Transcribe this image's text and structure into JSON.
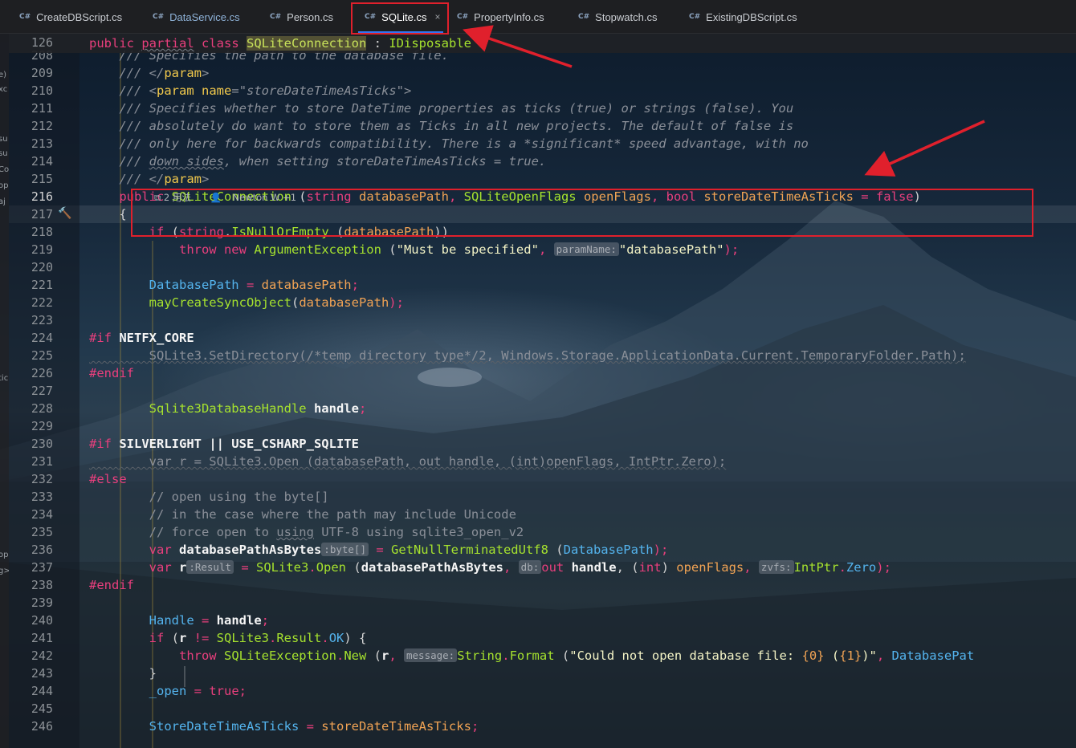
{
  "tabs": [
    {
      "label": "CreateDBScript.cs",
      "badge": "C#",
      "active": false
    },
    {
      "label": "DataService.cs",
      "badge": "C#",
      "active": false
    },
    {
      "label": "Person.cs",
      "badge": "C#",
      "active": false
    },
    {
      "label": "SQLite.cs",
      "badge": "C#",
      "active": true
    },
    {
      "label": "PropertyInfo.cs",
      "badge": "C#",
      "active": false
    },
    {
      "label": "Stopwatch.cs",
      "badge": "C#",
      "active": false
    },
    {
      "label": "ExistingDBScript.cs",
      "badge": "C#",
      "active": false
    }
  ],
  "tab_close_glyph": "×",
  "left_panel_fragments": [
    "e)",
    "xc",
    "su",
    "su",
    "Co",
    "op",
    "aj",
    "tic",
    "op",
    "g>"
  ],
  "sticky": {
    "line": "126",
    "tokens": [
      {
        "text": "public ",
        "cls": "k"
      },
      {
        "text": "partial",
        "cls": "k underl"
      },
      {
        "text": " ",
        "cls": ""
      },
      {
        "text": "class",
        "cls": "k"
      },
      {
        "text": " ",
        "cls": ""
      },
      {
        "text": "SQLiteConnection",
        "cls": "hl"
      },
      {
        "text": " : ",
        "cls": ""
      },
      {
        "text": "IDisposable",
        "cls": "g"
      }
    ]
  },
  "code_lens": {
    "usages": "2 用法",
    "authors": "Newton W +1"
  },
  "lines": [
    {
      "n": "208",
      "tokens": [
        {
          "text": "    /// Specifies the path to the database file.",
          "cls": "cm"
        }
      ]
    },
    {
      "n": "209",
      "tokens": [
        {
          "text": "    /// </",
          "cls": "cm"
        },
        {
          "text": "param",
          "cls": "t"
        },
        {
          "text": ">",
          "cls": "cm"
        }
      ]
    },
    {
      "n": "210",
      "tokens": [
        {
          "text": "    /// <",
          "cls": "cm"
        },
        {
          "text": "param",
          "cls": "t"
        },
        {
          "text": " ",
          "cls": "cm"
        },
        {
          "text": "name",
          "cls": "t"
        },
        {
          "text": "=",
          "cls": "cm"
        },
        {
          "text": "\"storeDateTimeAsTicks\"",
          "cls": "cm"
        },
        {
          "text": ">",
          "cls": "cm"
        }
      ]
    },
    {
      "n": "211",
      "tokens": [
        {
          "text": "    /// Specifies whether to store DateTime properties as ticks (true) or strings (false). You",
          "cls": "cm"
        }
      ]
    },
    {
      "n": "212",
      "tokens": [
        {
          "text": "    /// absolutely do want to store them as Ticks in all new projects. The default of false is",
          "cls": "cm"
        }
      ]
    },
    {
      "n": "213",
      "tokens": [
        {
          "text": "    /// only here for backwards compatibility. There is a *significant* speed advantage, with no",
          "cls": "cm"
        }
      ]
    },
    {
      "n": "214",
      "tokens": [
        {
          "text": "    /// ",
          "cls": "cm"
        },
        {
          "text": "down sides",
          "cls": "cm underl"
        },
        {
          "text": ", when setting storeDateTimeAsTicks = true.",
          "cls": "cm"
        }
      ]
    },
    {
      "n": "215",
      "tokens": [
        {
          "text": "    /// </",
          "cls": "cm"
        },
        {
          "text": "param",
          "cls": "t"
        },
        {
          "text": ">",
          "cls": "cm"
        }
      ]
    },
    {
      "n": "216",
      "current": true,
      "tokens": [
        {
          "text": "    public ",
          "cls": "k"
        },
        {
          "text": "SQLiteConnection",
          "cls": "g"
        },
        {
          "text": " (",
          "cls": ""
        },
        {
          "text": "string",
          "cls": "k"
        },
        {
          "text": " ",
          "cls": ""
        },
        {
          "text": "databasePath",
          "cls": "p"
        },
        {
          "text": ", ",
          "cls": "k"
        },
        {
          "text": "SQLiteOpenFlags",
          "cls": "g"
        },
        {
          "text": " ",
          "cls": ""
        },
        {
          "text": "openFlags",
          "cls": "p"
        },
        {
          "text": ", ",
          "cls": "k"
        },
        {
          "text": "bool",
          "cls": "k"
        },
        {
          "text": " ",
          "cls": ""
        },
        {
          "text": "storeDateTimeAsTicks",
          "cls": "p"
        },
        {
          "text": " = ",
          "cls": "k"
        },
        {
          "text": "false",
          "cls": "k"
        },
        {
          "text": ")",
          "cls": ""
        }
      ]
    },
    {
      "n": "217",
      "tokens": [
        {
          "text": "    {",
          "cls": ""
        }
      ]
    },
    {
      "n": "218",
      "tokens": [
        {
          "text": "        if",
          "cls": "k"
        },
        {
          "text": " (",
          "cls": ""
        },
        {
          "text": "string",
          "cls": "k"
        },
        {
          "text": ".",
          "cls": ""
        },
        {
          "text": "IsNullOrEmpty",
          "cls": "g"
        },
        {
          "text": " (",
          "cls": ""
        },
        {
          "text": "databasePath",
          "cls": "p"
        },
        {
          "text": "))",
          "cls": ""
        }
      ]
    },
    {
      "n": "219",
      "tokens": [
        {
          "text": "            throw new ",
          "cls": "k"
        },
        {
          "text": "ArgumentException",
          "cls": "g"
        },
        {
          "text": " (",
          "cls": ""
        },
        {
          "text": "\"Must be specified\"",
          "cls": "s"
        },
        {
          "text": ", ",
          "cls": "k"
        },
        {
          "text": "paramName:",
          "cls": "hint"
        },
        {
          "text": "\"databasePath\"",
          "cls": "s"
        },
        {
          "text": ");",
          "cls": "k"
        }
      ]
    },
    {
      "n": "220",
      "tokens": []
    },
    {
      "n": "221",
      "tokens": [
        {
          "text": "        ",
          "cls": ""
        },
        {
          "text": "DatabasePath",
          "cls": "bl"
        },
        {
          "text": " = ",
          "cls": "k"
        },
        {
          "text": "databasePath",
          "cls": "p"
        },
        {
          "text": ";",
          "cls": "k"
        }
      ]
    },
    {
      "n": "222",
      "tokens": [
        {
          "text": "        ",
          "cls": ""
        },
        {
          "text": "mayCreateSyncObject",
          "cls": "g"
        },
        {
          "text": "(",
          "cls": ""
        },
        {
          "text": "databasePath",
          "cls": "p"
        },
        {
          "text": ");",
          "cls": "k"
        }
      ]
    },
    {
      "n": "223",
      "tokens": []
    },
    {
      "n": "224",
      "tokens": [
        {
          "text": "#if",
          "cls": "pp"
        },
        {
          "text": " NETFX_CORE",
          "cls": "w"
        }
      ]
    },
    {
      "n": "225",
      "tokens": [
        {
          "text": "        SQLite3.SetDirectory(/*temp directory type*/2, Windows.Storage.ApplicationData.Current.TemporaryFolder.Path);",
          "cls": "dim"
        }
      ]
    },
    {
      "n": "226",
      "tokens": [
        {
          "text": "#endif",
          "cls": "pp"
        }
      ]
    },
    {
      "n": "227",
      "tokens": []
    },
    {
      "n": "228",
      "tokens": [
        {
          "text": "        ",
          "cls": ""
        },
        {
          "text": "Sqlite3DatabaseHandle",
          "cls": "g"
        },
        {
          "text": " ",
          "cls": ""
        },
        {
          "text": "handle",
          "cls": "w"
        },
        {
          "text": ";",
          "cls": "k"
        }
      ]
    },
    {
      "n": "229",
      "tokens": []
    },
    {
      "n": "230",
      "tokens": [
        {
          "text": "#if",
          "cls": "pp"
        },
        {
          "text": " SILVERLIGHT || USE_CSHARP_SQLITE",
          "cls": "w"
        }
      ]
    },
    {
      "n": "231",
      "tokens": [
        {
          "text": "        var r = SQLite3.Open (databasePath, out handle, (int)openFlags, IntPtr.Zero);",
          "cls": "dim"
        }
      ]
    },
    {
      "n": "232",
      "tokens": [
        {
          "text": "#else",
          "cls": "pp"
        }
      ]
    },
    {
      "n": "233",
      "tokens": [
        {
          "text": "        // open using the byte[]",
          "cls": "cmt"
        }
      ]
    },
    {
      "n": "234",
      "tokens": [
        {
          "text": "        // in the case where the path may include Unicode",
          "cls": "cmt"
        }
      ]
    },
    {
      "n": "235",
      "tokens": [
        {
          "text": "        // force open to ",
          "cls": "cmt"
        },
        {
          "text": "using",
          "cls": "cmt underl"
        },
        {
          "text": " UTF-8 using sqlite3_open_v2",
          "cls": "cmt"
        }
      ]
    },
    {
      "n": "236",
      "tokens": [
        {
          "text": "        var ",
          "cls": "k"
        },
        {
          "text": "databasePathAsBytes",
          "cls": "w"
        },
        {
          "text": ":byte[]",
          "cls": "hint"
        },
        {
          "text": " = ",
          "cls": "k"
        },
        {
          "text": "GetNullTerminatedUtf8",
          "cls": "g"
        },
        {
          "text": " (",
          "cls": ""
        },
        {
          "text": "DatabasePath",
          "cls": "bl"
        },
        {
          "text": ");",
          "cls": "k"
        }
      ]
    },
    {
      "n": "237",
      "tokens": [
        {
          "text": "        var ",
          "cls": "k"
        },
        {
          "text": "r",
          "cls": "w"
        },
        {
          "text": ":Result",
          "cls": "hint"
        },
        {
          "text": " = ",
          "cls": "k"
        },
        {
          "text": "SQLite3",
          "cls": "g"
        },
        {
          "text": ".",
          "cls": "k"
        },
        {
          "text": "Open",
          "cls": "g"
        },
        {
          "text": " (",
          "cls": ""
        },
        {
          "text": "databasePathAsBytes",
          "cls": "w"
        },
        {
          "text": ", ",
          "cls": "k"
        },
        {
          "text": "db:",
          "cls": "hint"
        },
        {
          "text": "out ",
          "cls": "k"
        },
        {
          "text": "handle",
          "cls": "w"
        },
        {
          "text": ", (",
          "cls": ""
        },
        {
          "text": "int",
          "cls": "k"
        },
        {
          "text": ") ",
          "cls": ""
        },
        {
          "text": "openFlags",
          "cls": "p"
        },
        {
          "text": ", ",
          "cls": "k"
        },
        {
          "text": "zvfs:",
          "cls": "hint"
        },
        {
          "text": "IntPtr",
          "cls": "g"
        },
        {
          "text": ".",
          "cls": "k"
        },
        {
          "text": "Zero",
          "cls": "bl"
        },
        {
          "text": ");",
          "cls": "k"
        }
      ]
    },
    {
      "n": "238",
      "tokens": [
        {
          "text": "#endif",
          "cls": "pp"
        }
      ]
    },
    {
      "n": "239",
      "tokens": []
    },
    {
      "n": "240",
      "tokens": [
        {
          "text": "        ",
          "cls": ""
        },
        {
          "text": "Handle",
          "cls": "bl"
        },
        {
          "text": " = ",
          "cls": "k"
        },
        {
          "text": "handle",
          "cls": "w"
        },
        {
          "text": ";",
          "cls": "k"
        }
      ]
    },
    {
      "n": "241",
      "tokens": [
        {
          "text": "        if",
          "cls": "k"
        },
        {
          "text": " (",
          "cls": ""
        },
        {
          "text": "r",
          "cls": "w"
        },
        {
          "text": " != ",
          "cls": "k"
        },
        {
          "text": "SQLite3",
          "cls": "g"
        },
        {
          "text": ".",
          "cls": "k"
        },
        {
          "text": "Result",
          "cls": "g"
        },
        {
          "text": ".",
          "cls": "k"
        },
        {
          "text": "OK",
          "cls": "bl"
        },
        {
          "text": ") {",
          "cls": ""
        }
      ]
    },
    {
      "n": "242",
      "tokens": [
        {
          "text": "            throw ",
          "cls": "k"
        },
        {
          "text": "SQLiteException",
          "cls": "g"
        },
        {
          "text": ".",
          "cls": "k"
        },
        {
          "text": "New",
          "cls": "g"
        },
        {
          "text": " (",
          "cls": ""
        },
        {
          "text": "r",
          "cls": "w"
        },
        {
          "text": ", ",
          "cls": "k"
        },
        {
          "text": "message:",
          "cls": "hint"
        },
        {
          "text": "String",
          "cls": "g"
        },
        {
          "text": ".",
          "cls": "k"
        },
        {
          "text": "Format",
          "cls": "g"
        },
        {
          "text": " (",
          "cls": ""
        },
        {
          "text": "\"Could not open database file: ",
          "cls": "s"
        },
        {
          "text": "{0}",
          "cls": "p"
        },
        {
          "text": " (",
          "cls": "s"
        },
        {
          "text": "{1}",
          "cls": "p"
        },
        {
          "text": ")\"",
          "cls": "s"
        },
        {
          "text": ", ",
          "cls": "k"
        },
        {
          "text": "DatabasePat",
          "cls": "bl"
        }
      ]
    },
    {
      "n": "243",
      "tokens": [
        {
          "text": "        }",
          "cls": ""
        }
      ]
    },
    {
      "n": "244",
      "tokens": [
        {
          "text": "        ",
          "cls": ""
        },
        {
          "text": "_open",
          "cls": "bl"
        },
        {
          "text": " = ",
          "cls": "k"
        },
        {
          "text": "true",
          "cls": "k"
        },
        {
          "text": ";",
          "cls": "k"
        }
      ]
    },
    {
      "n": "245",
      "tokens": []
    },
    {
      "n": "246",
      "tokens": [
        {
          "text": "        ",
          "cls": ""
        },
        {
          "text": "StoreDateTimeAsTicks",
          "cls": "bl"
        },
        {
          "text": " = ",
          "cls": "k"
        },
        {
          "text": "storeDateTimeAsTicks",
          "cls": "p"
        },
        {
          "text": ";",
          "cls": "k"
        }
      ]
    }
  ],
  "colors": {
    "keyword": "#e93f7d",
    "type": "#a6e22e",
    "parameter": "#f1a354",
    "property": "#54b4ee",
    "annotation_red": "#e0202c",
    "active_tab_underline": "#3574f0"
  },
  "icons": {
    "current_line_gutter": "hammer-icon",
    "lens_usages": "usages-icon",
    "lens_authors": "person-icon"
  }
}
